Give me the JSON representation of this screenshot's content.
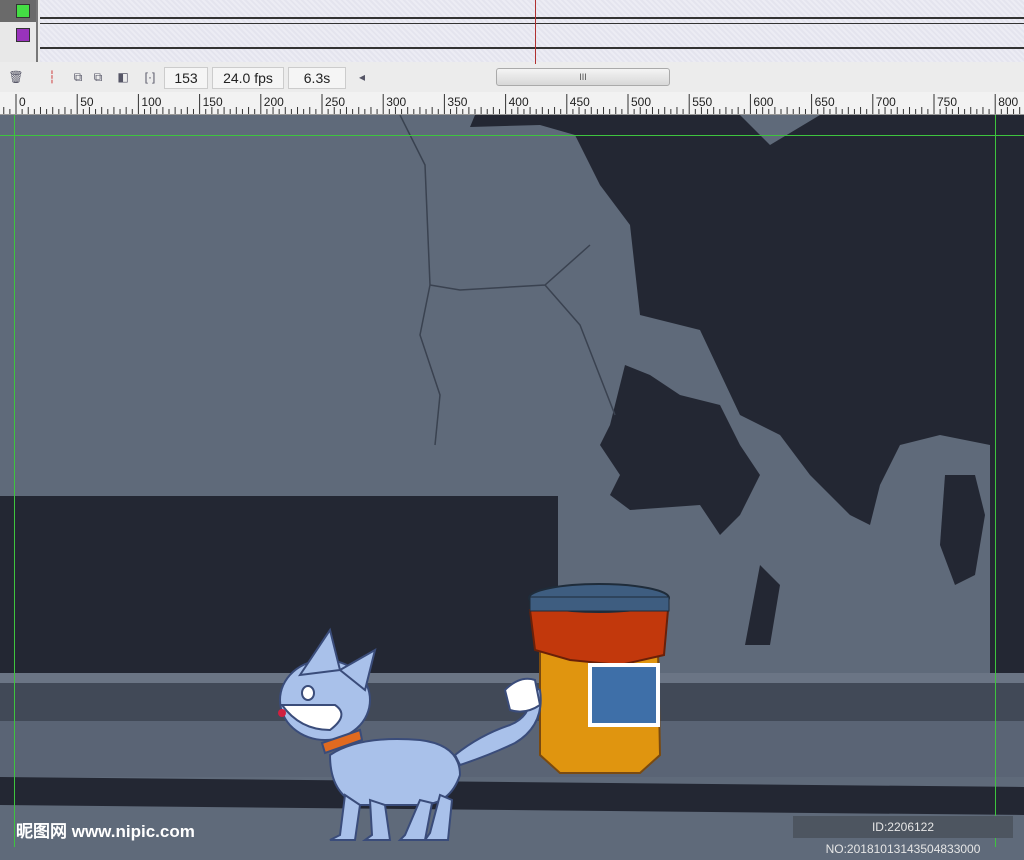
{
  "timeline": {
    "layers": [
      {
        "color": "#44dd44"
      },
      {
        "color": "#9933bb"
      }
    ],
    "current_frame": "153",
    "fps": "24.0 fps",
    "elapsed": "6.3s",
    "scroll_thumb_grip": "III",
    "scroll_left_arrow": "◂"
  },
  "ruler": {
    "labels": [
      "0",
      "50",
      "100",
      "150",
      "200",
      "250",
      "300",
      "350",
      "400",
      "450",
      "500",
      "550",
      "600",
      "650",
      "700",
      "750",
      "800"
    ]
  },
  "watermark": {
    "site": "昵图网 www.nipic.com",
    "id": "ID:2206122 NO:20181013143504833000"
  }
}
